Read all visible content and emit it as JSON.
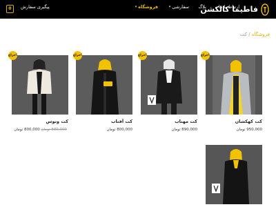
{
  "header": {
    "brand_title": "فاطیما کالکشن",
    "cart_count": "0",
    "nav": [
      {
        "label": "فروشگاه",
        "active": true,
        "has_caret": true
      },
      {
        "label": "سفارشی",
        "active": false,
        "has_caret": true
      },
      {
        "label": "بلاگ",
        "active": false,
        "has_caret": false
      },
      {
        "label": "ارتباط با ما",
        "active": false,
        "has_caret": false
      },
      {
        "label": "پیگیری سفارش",
        "active": false,
        "has_caret": false
      }
    ]
  },
  "breadcrumb": {
    "shop": "فروشگاه",
    "separator": " / ",
    "current": "کت"
  },
  "sale_badge": "حراج!",
  "products": [
    {
      "name": "کت کهکشان",
      "old_price": "",
      "price": "950,000 تومان",
      "photo": "woman in grey coat with yellow lining"
    },
    {
      "name": "کت مهتاب",
      "old_price": "",
      "price": "890,000 تومان",
      "photo": "woman in black blazer with patterned scarf"
    },
    {
      "name": "کت آفتاب",
      "old_price": "",
      "price": "800,000 تومان",
      "photo": "woman in black coat with yellow clutch"
    },
    {
      "name": "کت ونوس",
      "old_price": "880,000 تومان",
      "price": "800,000 تومان",
      "photo": "woman in cream blazer"
    },
    {
      "name": "",
      "old_price": "",
      "price": "",
      "photo": "woman in black blazer with yellow scarf"
    }
  ],
  "colors": {
    "accent": "#f2c200",
    "header_bg": "#000000",
    "photo_bg": "#4a4a4a"
  }
}
